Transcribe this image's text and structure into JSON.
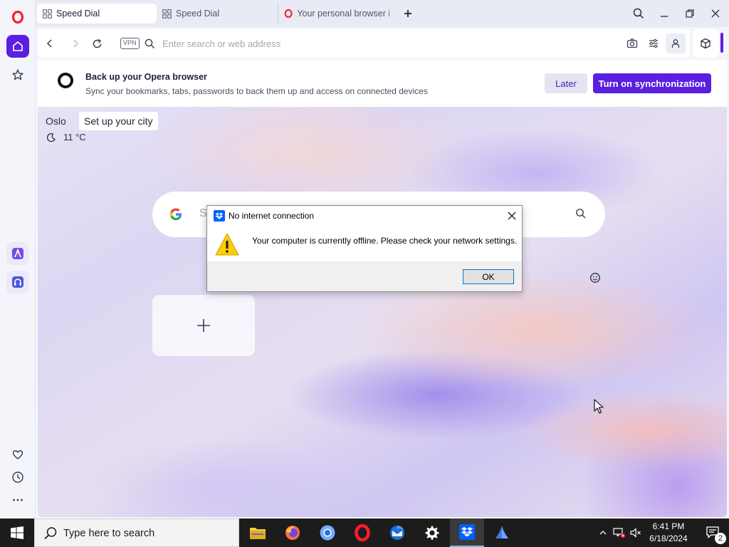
{
  "browser": {
    "tabs": [
      {
        "label": "Speed Dial",
        "active": true
      },
      {
        "label": "Speed Dial",
        "active": false
      },
      {
        "label": "Your personal browser is a",
        "active": false
      }
    ],
    "address_bar": {
      "vpn_label": "VPN",
      "placeholder": "Enter search or web address",
      "value": ""
    },
    "sync_banner": {
      "title": "Back up your Opera browser",
      "description": "Sync your bookmarks, tabs, passwords to back them up and access on connected devices",
      "later_label": "Later",
      "sync_label": "Turn on synchronization"
    },
    "weather": {
      "city": "Oslo",
      "setup_label": "Set up your city",
      "temperature": "11 °C"
    },
    "search": {
      "placeholder": "S"
    }
  },
  "dialog": {
    "title": "No internet connection",
    "message": "Your computer is currently offline. Please check your network settings.",
    "ok_label": "OK"
  },
  "taskbar": {
    "search_placeholder": "Type here to search",
    "time": "6:41 PM",
    "date": "6/18/2024",
    "notification_count": "2"
  },
  "colors": {
    "accent": "#5b1fe0",
    "sync_button": "#5b1fe0",
    "dialog_ok_border": "#0078d7",
    "taskbar": "#1c1c1c"
  }
}
